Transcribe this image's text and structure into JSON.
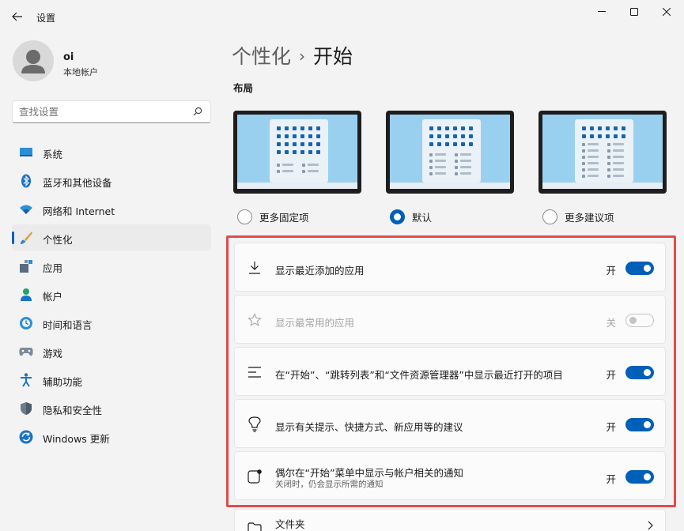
{
  "window": {
    "title": "设置"
  },
  "user": {
    "name": "oi",
    "account_type": "本地帐户"
  },
  "search": {
    "placeholder": "查找设置"
  },
  "nav": {
    "items": [
      {
        "label": "系统",
        "icon": "system-icon"
      },
      {
        "label": "蓝牙和其他设备",
        "icon": "bluetooth-icon"
      },
      {
        "label": "网络和 Internet",
        "icon": "wifi-icon"
      },
      {
        "label": "个性化",
        "icon": "brush-icon",
        "active": true
      },
      {
        "label": "应用",
        "icon": "apps-icon"
      },
      {
        "label": "帐户",
        "icon": "account-icon"
      },
      {
        "label": "时间和语言",
        "icon": "clock-globe-icon"
      },
      {
        "label": "游戏",
        "icon": "gamepad-icon"
      },
      {
        "label": "辅助功能",
        "icon": "accessibility-icon"
      },
      {
        "label": "隐私和安全性",
        "icon": "shield-icon"
      },
      {
        "label": "Windows 更新",
        "icon": "update-icon"
      }
    ]
  },
  "breadcrumb": {
    "parent": "个性化",
    "separator": "›",
    "current": "开始"
  },
  "layout": {
    "title": "布局",
    "options": [
      {
        "label": "更多固定项",
        "selected": false
      },
      {
        "label": "默认",
        "selected": true
      },
      {
        "label": "更多建议项",
        "selected": false
      }
    ]
  },
  "settings": [
    {
      "title": "显示最近添加的应用",
      "state_label": "开",
      "on": true,
      "icon": "download-icon"
    },
    {
      "title": "显示最常用的应用",
      "state_label": "关",
      "on": false,
      "disabled": true,
      "icon": "star-icon"
    },
    {
      "title": "在“开始”、“跳转列表”和“文件资源管理器”中显示最近打开的项目",
      "state_label": "开",
      "on": true,
      "icon": "list-icon"
    },
    {
      "title": "显示有关提示、快捷方式、新应用等的建议",
      "state_label": "开",
      "on": true,
      "icon": "lightbulb-icon"
    },
    {
      "title": "偶尔在“开始”菜单中显示与帐户相关的通知",
      "subtitle": "关闭时，仍会显示所需的通知",
      "state_label": "开",
      "on": true,
      "icon": "notification-icon"
    }
  ],
  "folders": {
    "title": "文件夹"
  },
  "colors": {
    "accent": "#005fb8",
    "highlight_border": "#e14b4b"
  }
}
